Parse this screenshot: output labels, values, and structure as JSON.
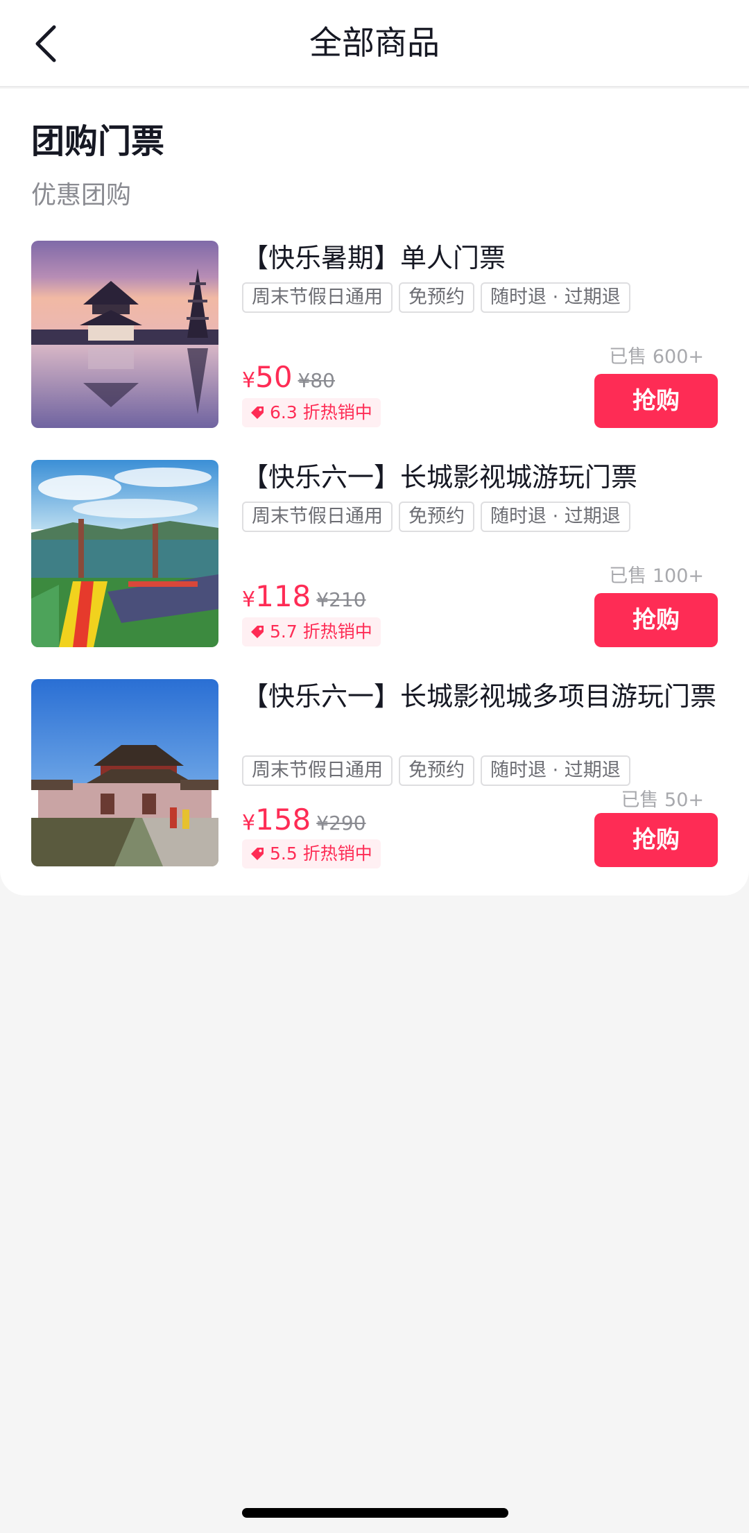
{
  "nav": {
    "title": "全部商品",
    "back_icon": "chevron-left-icon"
  },
  "section": {
    "title": "团购门票",
    "subtitle": "优惠团购"
  },
  "colors": {
    "accent": "#fe2c55",
    "tag_border": "#dedee0"
  },
  "products": [
    {
      "title": "【快乐暑期】单人门票",
      "tags": [
        "周末节假日通用",
        "免预约",
        "随时退 · 过期退"
      ],
      "currency": "¥",
      "price": "50",
      "original_price": "¥80",
      "discount": "6.3 折热销中",
      "sold": "已售 600+",
      "buy_label": "抢购",
      "image": "pagoda-lake-photo"
    },
    {
      "title": "【快乐六一】长城影视城游玩门票",
      "tags": [
        "周末节假日通用",
        "免预约",
        "随时退 · 过期退"
      ],
      "currency": "¥",
      "price": "118",
      "original_price": "¥210",
      "discount": "5.7 折热销中",
      "sold": "已售 100+",
      "buy_label": "抢购",
      "image": "lake-slide-photo"
    },
    {
      "title": "【快乐六一】长城影视城多项目游玩门票",
      "tags": [
        "周末节假日通用",
        "免预约",
        "随时退 · 过期退"
      ],
      "currency": "¥",
      "price": "158",
      "original_price": "¥290",
      "discount": "5.5 折热销中",
      "sold": "已售 50+",
      "buy_label": "抢购",
      "image": "palace-gate-photo"
    }
  ]
}
